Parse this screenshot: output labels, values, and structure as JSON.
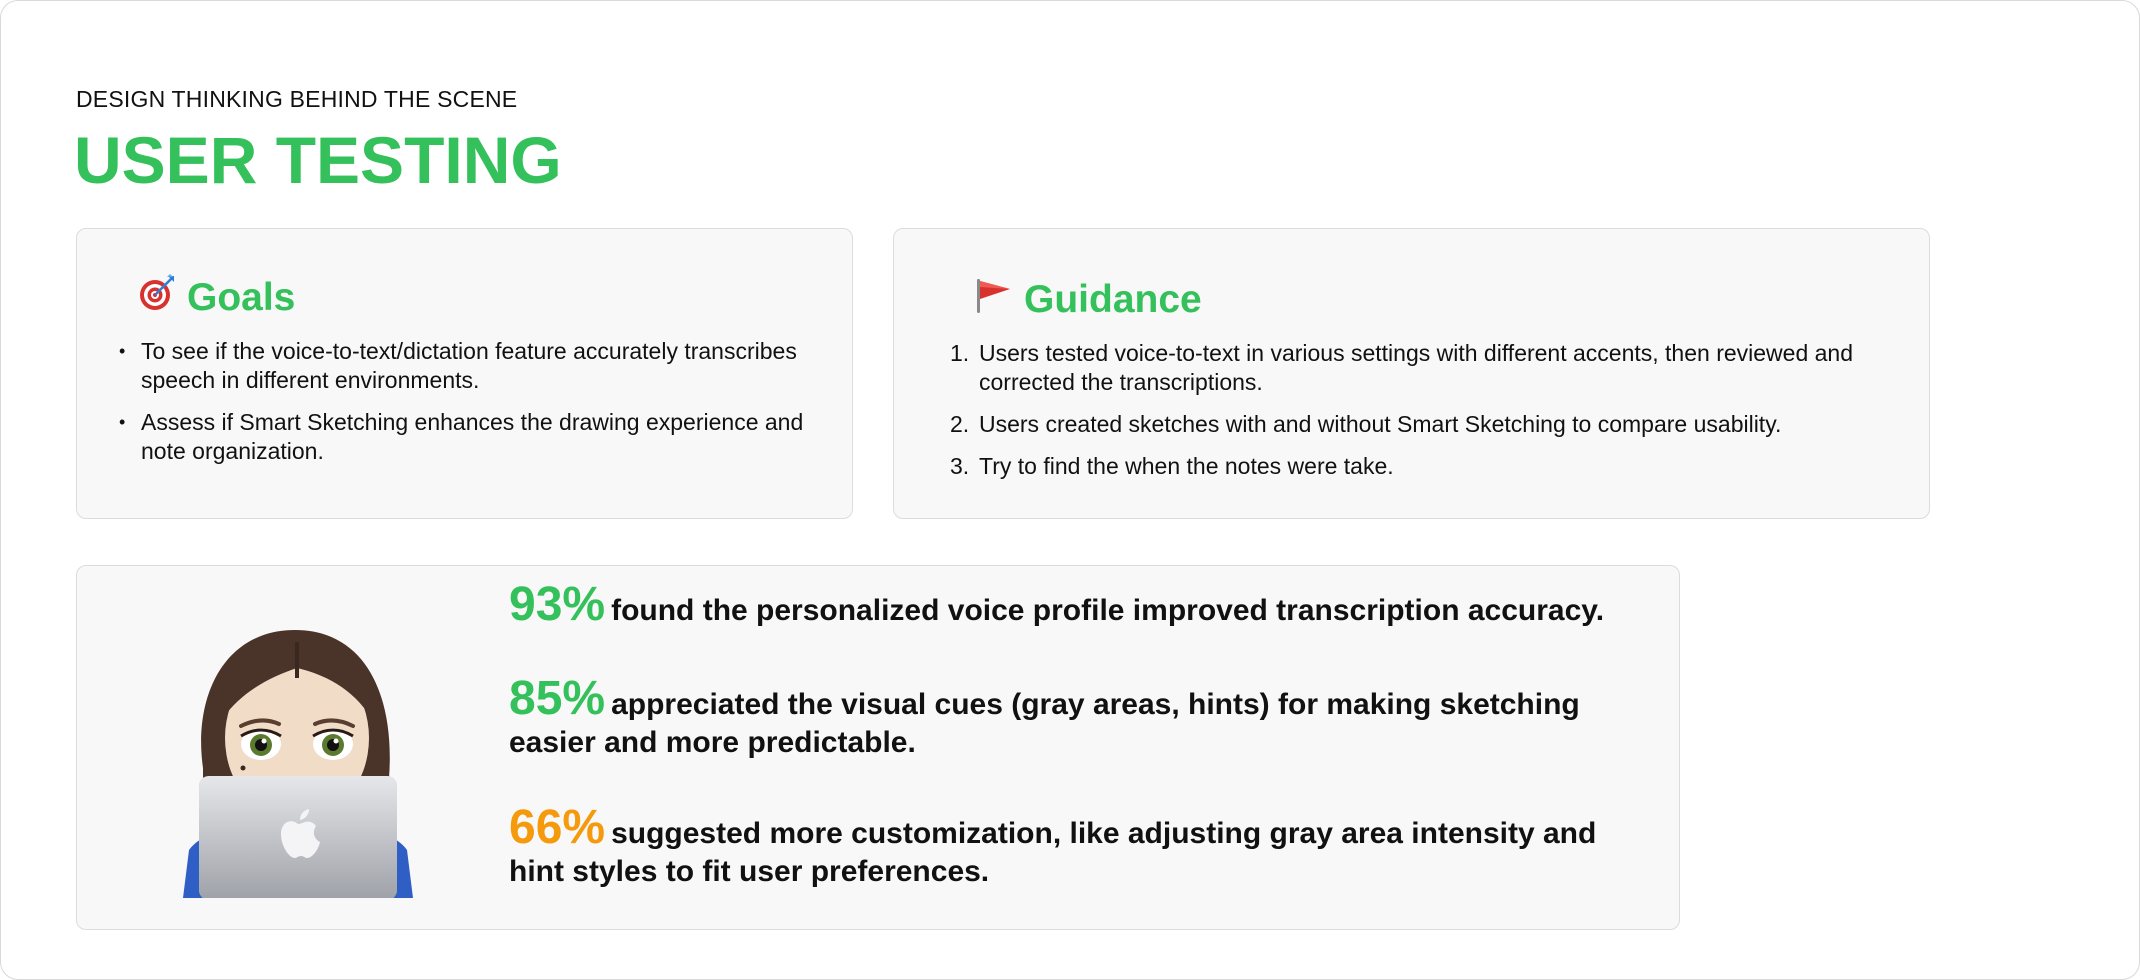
{
  "header": {
    "eyebrow": "DESIGN THINKING BEHIND THE SCENE",
    "title": "USER TESTING"
  },
  "colors": {
    "accent_green": "#34c05a",
    "accent_orange": "#f59a0c",
    "card_bg": "#f8f8f8"
  },
  "goals": {
    "icon": "target-icon",
    "title": "Goals",
    "items": [
      "To see if the voice-to-text/dictation feature accurately transcribes speech in different environments.",
      "Assess if Smart Sketching enhances the drawing experience and note organization."
    ]
  },
  "guidance": {
    "icon": "flag-icon",
    "title": "Guidance",
    "items": [
      {
        "num": "1.",
        "text": "Users tested voice-to-text in various settings with different accents, then reviewed and corrected the transcriptions."
      },
      {
        "num": "2.",
        "text": "Users created sketches with and without Smart Sketching to compare usability."
      },
      {
        "num": "3.",
        "text": "Try to find the when the notes were take."
      }
    ]
  },
  "results": {
    "avatar_icon": "memoji-laptop-icon",
    "stats": [
      {
        "percent": "93%",
        "text": "found the personalized voice profile improved transcription accuracy.",
        "color": "#34c05a"
      },
      {
        "percent": "85%",
        "text": "appreciated the visual cues (gray areas, hints) for making sketching easier and more predictable.",
        "color": "#34c05a"
      },
      {
        "percent": "66%",
        "text": "suggested more customization, like adjusting gray area intensity and hint styles to fit user preferences.",
        "color": "#f59a0c"
      }
    ]
  }
}
